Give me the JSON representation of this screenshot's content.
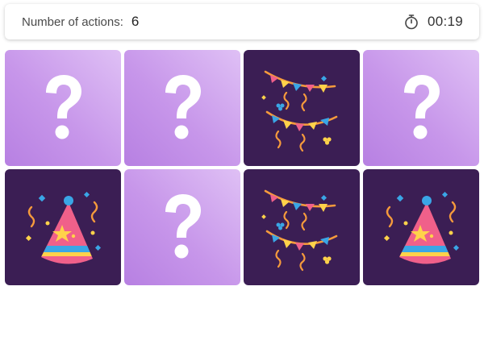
{
  "status": {
    "actions_label": "Number of actions:",
    "actions_count": "6",
    "timer": "00:19",
    "timer_icon": "stopwatch-icon"
  },
  "board": {
    "rows": 2,
    "columns": 4,
    "cards": [
      {
        "state": "hidden",
        "face": "question-mark"
      },
      {
        "state": "hidden",
        "face": "question-mark"
      },
      {
        "state": "revealed",
        "face": "party-garland"
      },
      {
        "state": "hidden",
        "face": "question-mark"
      },
      {
        "state": "revealed",
        "face": "party-hat"
      },
      {
        "state": "hidden",
        "face": "question-mark"
      },
      {
        "state": "revealed",
        "face": "party-garland"
      },
      {
        "state": "revealed",
        "face": "party-hat"
      }
    ]
  },
  "colors": {
    "hidden_card_light": "#dfc0f5",
    "hidden_card_dark": "#b780e2",
    "revealed_card": "#3b1e54",
    "hat_pink": "#f0608a",
    "hat_stripe_blue": "#3aa6e6",
    "star_yellow": "#ffd24a",
    "garland_orange": "#f59a3c"
  }
}
